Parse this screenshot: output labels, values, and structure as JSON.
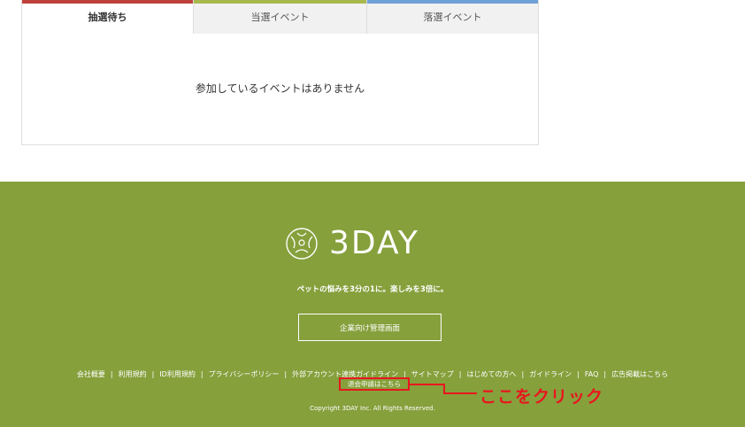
{
  "tabs": [
    {
      "label": "抽選待ち",
      "color": "#c0413b"
    },
    {
      "label": "当選イベント",
      "color": "#a8b84d"
    },
    {
      "label": "落選イベント",
      "color": "#6fa0d6"
    }
  ],
  "panel": {
    "message": "参加しているイベントはありません"
  },
  "footer": {
    "background": "#86a03c",
    "logo_text": "3DAY",
    "tagline": "ペットの悩みを3分の1に。楽しみを3倍に。",
    "corporate_button": "企業向け管理画面",
    "links": [
      "会社概要",
      "利用規約",
      "ID利用規約",
      "プライバシーポリシー",
      "外部アカウント連携ガイドライン",
      "サイトマップ",
      "はじめての方へ",
      "ガイドライン",
      "FAQ",
      "広告掲載はこちら"
    ],
    "withdraw_link": "退会申請はこちら",
    "copyright": "Copyright 3DAY Inc. All Rights Reserved."
  },
  "annotation": {
    "text": "ここをクリック",
    "color": "#e8161e"
  }
}
